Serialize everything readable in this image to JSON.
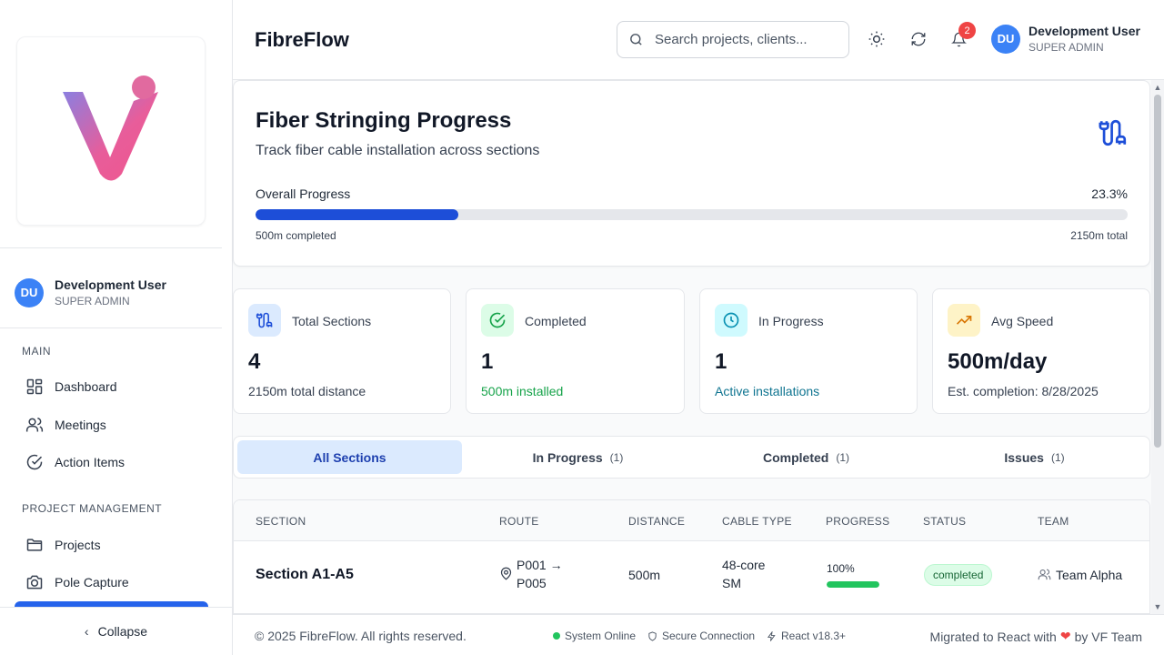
{
  "sidebar": {
    "user": {
      "initials": "DU",
      "name": "Development User",
      "role": "SUPER ADMIN"
    },
    "sections": [
      {
        "label": "MAIN",
        "items": [
          {
            "label": "Dashboard",
            "icon": "dashboard-icon"
          },
          {
            "label": "Meetings",
            "icon": "users-icon"
          },
          {
            "label": "Action Items",
            "icon": "check-circle-icon"
          }
        ]
      },
      {
        "label": "PROJECT MANAGEMENT",
        "items": [
          {
            "label": "Projects",
            "icon": "folder-icon"
          },
          {
            "label": "Pole Capture",
            "icon": "camera-icon"
          }
        ]
      }
    ],
    "collapse_label": "Collapse"
  },
  "header": {
    "title": "FibreFlow",
    "search_placeholder": "Search projects, clients...",
    "notifications_count": "2",
    "user": {
      "initials": "DU",
      "name": "Development User",
      "role": "SUPER ADMIN"
    }
  },
  "progress": {
    "title": "Fiber Stringing Progress",
    "subtitle": "Track fiber cable installation across sections",
    "overall_label": "Overall Progress",
    "percent_label": "23.3%",
    "percent_value": 23.3,
    "completed_label": "500m completed",
    "total_label": "2150m total"
  },
  "stats": [
    {
      "label": "Total Sections",
      "value": "4",
      "note": "2150m total distance",
      "icon": "cable-icon",
      "bg": "#dbeafe",
      "fg": "#1d4ed8",
      "note_color": "#374151"
    },
    {
      "label": "Completed",
      "value": "1",
      "note": "500m installed",
      "icon": "check-circle-icon",
      "bg": "#dcfce7",
      "fg": "#16a34a",
      "note_color": "#16a34a"
    },
    {
      "label": "In Progress",
      "value": "1",
      "note": "Active installations",
      "icon": "clock-icon",
      "bg": "#cffafe",
      "fg": "#0891b2",
      "note_color": "#0e7490"
    },
    {
      "label": "Avg Speed",
      "value": "500m/day",
      "note": "Est. completion: 8/28/2025",
      "icon": "trending-up-icon",
      "bg": "#fef3c7",
      "fg": "#d97706",
      "note_color": "#374151"
    }
  ],
  "tabs": [
    {
      "label": "All Sections",
      "count": ""
    },
    {
      "label": "In Progress",
      "count": "(1)"
    },
    {
      "label": "Completed",
      "count": "(1)"
    },
    {
      "label": "Issues",
      "count": "(1)"
    }
  ],
  "table": {
    "headers": [
      "SECTION",
      "ROUTE",
      "DISTANCE",
      "CABLE TYPE",
      "PROGRESS",
      "STATUS",
      "TEAM"
    ],
    "rows": [
      {
        "section": "Section A1-A5",
        "route_from": "P001 →",
        "route_to": "P005",
        "distance": "500m",
        "cable_line1": "48-core",
        "cable_line2": "SM",
        "progress_label": "100%",
        "progress_value": 100,
        "status": "completed",
        "team": "Team Alpha"
      }
    ]
  },
  "footer": {
    "copyright": "© 2025 FibreFlow. All rights reserved.",
    "system": "System Online",
    "secure": "Secure Connection",
    "react": "React v18.3+",
    "migrated_prefix": "Migrated to React with",
    "migrated_suffix": "by VF Team"
  },
  "colors": {
    "accent": "#2563eb",
    "danger": "#ef4444",
    "success": "#22c55e"
  }
}
